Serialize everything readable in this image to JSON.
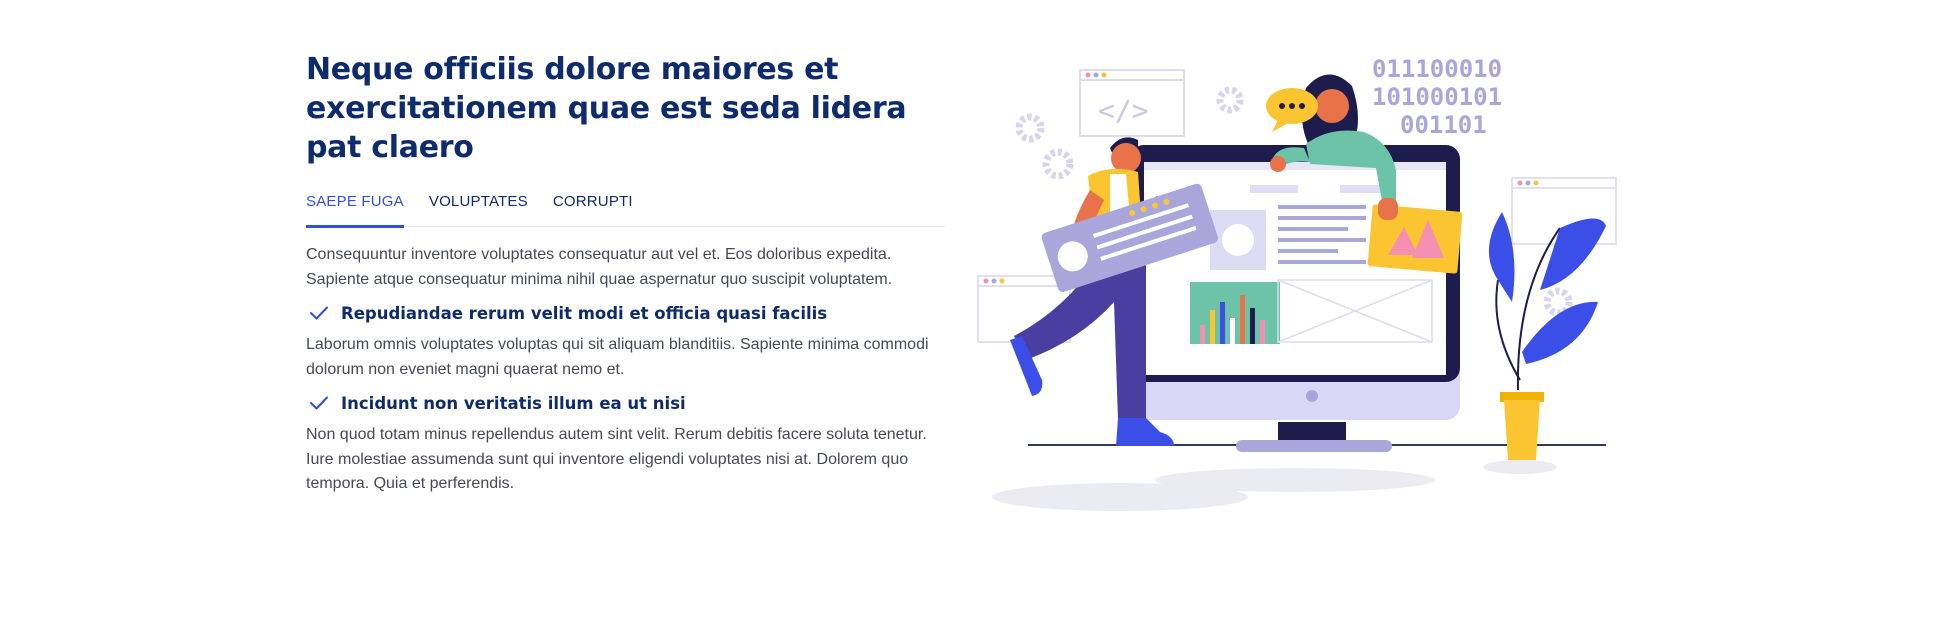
{
  "section": {
    "title": "Neque officiis dolore maiores et exercitationem quae est seda lidera pat claero",
    "tabs": [
      {
        "label": "SAEPE FUGA",
        "active": true
      },
      {
        "label": "VOLUPTATES",
        "active": false
      },
      {
        "label": "CORRUPTI",
        "active": false
      }
    ],
    "intro": "Consequuntur inventore voluptates consequatur aut vel et. Eos doloribus expedita. Sapiente atque consequatur minima nihil quae aspernatur quo suscipit voluptatem.",
    "features": [
      {
        "icon": "check-icon",
        "title": "Repudiandae rerum velit modi et officia quasi facilis",
        "text": "Laborum omnis voluptates voluptas qui sit aliquam blanditiis. Sapiente minima commodi dolorum non eveniet magni quaerat nemo et."
      },
      {
        "icon": "check-icon",
        "title": "Incidunt non veritatis illum ea ut nisi",
        "text": "Non quod totam minus repellendus autem sint velit. Rerum debitis facere soluta tenetur. Iure molestiae assumenda sunt qui inventore eligendi voluptates nisi at. Dolorem quo tempora. Quia et perferendis."
      }
    ]
  },
  "illustration": {
    "binary_lines": [
      "011100010",
      "101000101",
      "001101"
    ],
    "colors": {
      "heading": "#0e2b6e",
      "accent": "#2f4fe0",
      "body_text": "#444a55",
      "illustration_purple": "#a9a6dc",
      "illustration_yellow": "#fbc531",
      "illustration_green": "#6cc3a8",
      "illustration_blue": "#3b4fe8"
    }
  }
}
